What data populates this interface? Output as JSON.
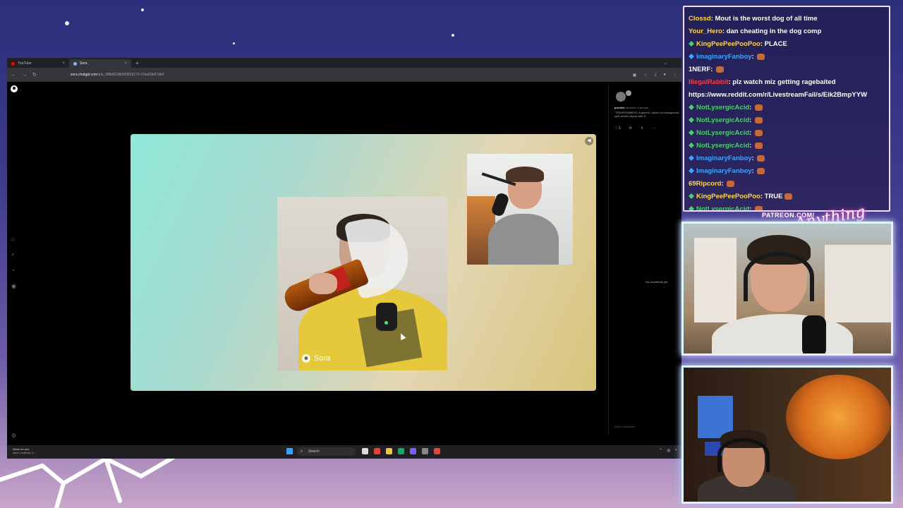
{
  "browser": {
    "tabs": [
      {
        "label": "YouTube",
        "favicon_color": "#ff0000",
        "active": false
      },
      {
        "label": "Sora",
        "favicon_color": "#8ab4f8",
        "active": true
      }
    ],
    "url_host": "sora.chatgpt.com",
    "url_path": "/p/s_68fb862db950815175 47ae93b67db4"
  },
  "sora": {
    "watermark": "Sora",
    "post": {
      "username": "prontot",
      "meta": "cameoed 2 people",
      "description": "\"\"ENVIRONMENT: A generic, pastel-co background, split-screen layout with S",
      "likes": "1"
    },
    "no_comments": "No comments yet",
    "comment_placeholder": "Add a comment..."
  },
  "taskbar": {
    "news_title": "News for you",
    "news_sub": "Jane Lockhart, b...",
    "search_label": "Search",
    "accent": "#3aa0ff"
  },
  "chat": {
    "messages": [
      {
        "user": "Clossd",
        "color": "#ffd54a",
        "text": "Mout is the worst dog of all time",
        "badge": "",
        "emote": false
      },
      {
        "user": "Your_Hero",
        "color": "#ffd54a",
        "text": "dan cheating in the dog comp",
        "badge": "",
        "emote": false
      },
      {
        "user": "KingPeePeePooPoo",
        "color": "#ffd54a",
        "text": "PLACE",
        "badge": "green",
        "emote": false
      },
      {
        "user": "ImaginaryFanboy",
        "color": "#3da5ff",
        "text": "",
        "badge": "blue",
        "emote": true
      },
      {
        "user": "1NERF",
        "color": "#ffffff",
        "text": "",
        "badge": "",
        "emote": true
      },
      {
        "user": "IllegalRabbit",
        "color": "#ff3a3a",
        "text": "plz watch miz getting ragebaited",
        "badge": "",
        "emote": false
      },
      {
        "user": "",
        "color": "#ffffff",
        "text": "https://www.reddit.com/r/LivestreamFail/s/Eik2BmpYYW",
        "badge": "",
        "emote": false
      },
      {
        "user": "NotLysergicAcid",
        "color": "#4cd06b",
        "text": "",
        "badge": "green",
        "emote": true
      },
      {
        "user": "NotLysergicAcid",
        "color": "#4cd06b",
        "text": "",
        "badge": "green",
        "emote": true
      },
      {
        "user": "NotLysergicAcid",
        "color": "#4cd06b",
        "text": "",
        "badge": "green",
        "emote": true
      },
      {
        "user": "NotLysergicAcid",
        "color": "#4cd06b",
        "text": "",
        "badge": "green",
        "emote": true
      },
      {
        "user": "ImaginaryFanboy",
        "color": "#3da5ff",
        "text": "",
        "badge": "blue",
        "emote": true
      },
      {
        "user": "ImaginaryFanboy",
        "color": "#3da5ff",
        "text": "",
        "badge": "blue",
        "emote": true
      },
      {
        "user": "69Ripcord",
        "color": "#ffd54a",
        "text": "",
        "badge": "",
        "emote": true
      },
      {
        "user": "KingPeePeePooPoo",
        "color": "#ffd54a",
        "text": "TRUE",
        "badge": "green",
        "emote": true
      },
      {
        "user": "NotLysergicAcid",
        "color": "#4cd06b",
        "text": "",
        "badge": "green",
        "emote": true
      }
    ]
  },
  "overlay": {
    "patreon": "PATREON.COM/",
    "brand": "Anything Else"
  }
}
